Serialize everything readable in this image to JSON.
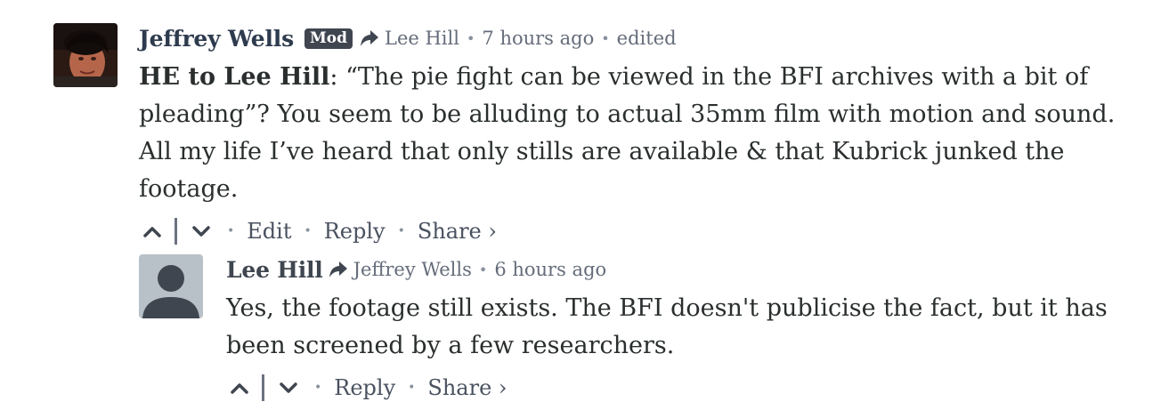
{
  "comments": [
    {
      "author": "Jeffrey Wells",
      "badge": "Mod",
      "reply_to": "Lee Hill",
      "time": "7 hours ago",
      "edited": "edited",
      "text_bold": "HE to Lee Hill",
      "text_rest": ": “The pie fight can be viewed in the BFI archives with a bit of pleading”? You seem to be alluding to actual 35mm film with motion and sound. All my life I’ve heard that only stills are available & that Kubrick junked the footage.",
      "actions": {
        "edit": "Edit",
        "reply": "Reply",
        "share": "Share ›"
      }
    },
    {
      "author": "Lee Hill",
      "reply_to": "Jeffrey Wells",
      "time": "6 hours ago",
      "text": "Yes, the footage still exists. The BFI doesn't publicise the fact, but it has been screened by a few researchers.",
      "actions": {
        "reply": "Reply",
        "share": "Share ›"
      }
    }
  ],
  "icons": {
    "reply_arrow": "reply-arrow-icon",
    "upvote": "chevron-up-icon",
    "downvote": "chevron-down-icon",
    "default_avatar": "user-silhouette-icon"
  },
  "colors": {
    "author": "#2e3b4e",
    "meta": "#656c7a",
    "badge_bg": "#3f4650",
    "text": "#2a2e2e"
  }
}
